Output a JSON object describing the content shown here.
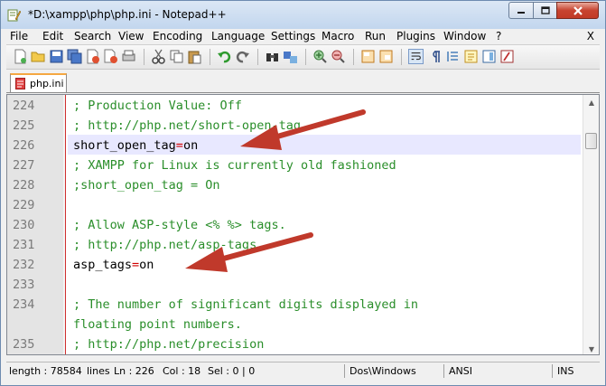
{
  "window": {
    "title": "*D:\\xampp\\php\\php.ini - Notepad++"
  },
  "menu": {
    "items": [
      "File",
      "Edit",
      "Search",
      "View",
      "Encoding",
      "Language",
      "Settings",
      "Macro",
      "Run",
      "Plugins",
      "Window",
      "?"
    ],
    "close_label": "X"
  },
  "tab": {
    "label": "php.ini"
  },
  "editor": {
    "lines": [
      {
        "num": "224",
        "text": "; Production Value: Off",
        "kind": "comment"
      },
      {
        "num": "225",
        "text": "; http://php.net/short-open-tag",
        "kind": "comment"
      },
      {
        "num": "226",
        "text": "short_open_tag=on",
        "kind": "directive"
      },
      {
        "num": "227",
        "text": "; XAMPP for Linux is currently old fashioned",
        "kind": "comment"
      },
      {
        "num": "228",
        "text": ";short_open_tag = On",
        "kind": "comment"
      },
      {
        "num": "229",
        "text": "",
        "kind": "blank"
      },
      {
        "num": "230",
        "text": "; Allow ASP-style <% %> tags.",
        "kind": "comment"
      },
      {
        "num": "231",
        "text": "; http://php.net/asp-tags",
        "kind": "comment"
      },
      {
        "num": "232",
        "text": "asp_tags=on",
        "kind": "directive"
      },
      {
        "num": "233",
        "text": "",
        "kind": "blank"
      },
      {
        "num": "234",
        "text": "; The number of significant digits displayed in",
        "kind": "comment"
      },
      {
        "num": "",
        "text": "floating point numbers.",
        "kind": "comment"
      },
      {
        "num": "235",
        "text": "; http://php.net/precision",
        "kind": "comment"
      }
    ],
    "directive_226": {
      "key": "short_open_tag",
      "op": "=",
      "value": "on"
    },
    "directive_232": {
      "key": "asp_tags",
      "op": "=",
      "value": "on"
    }
  },
  "status": {
    "length": "length : 78584",
    "lines": "lines",
    "ln": "Ln : 226",
    "col": "Col : 18",
    "sel": "Sel : 0 | 0",
    "eol": "Dos\\Windows",
    "encoding": "ANSI",
    "mode": "INS"
  },
  "colors": {
    "comment": "#2a8e2a",
    "operator": "#d00000",
    "arrow": "#c0392b",
    "tab_accent": "#f5a742"
  }
}
